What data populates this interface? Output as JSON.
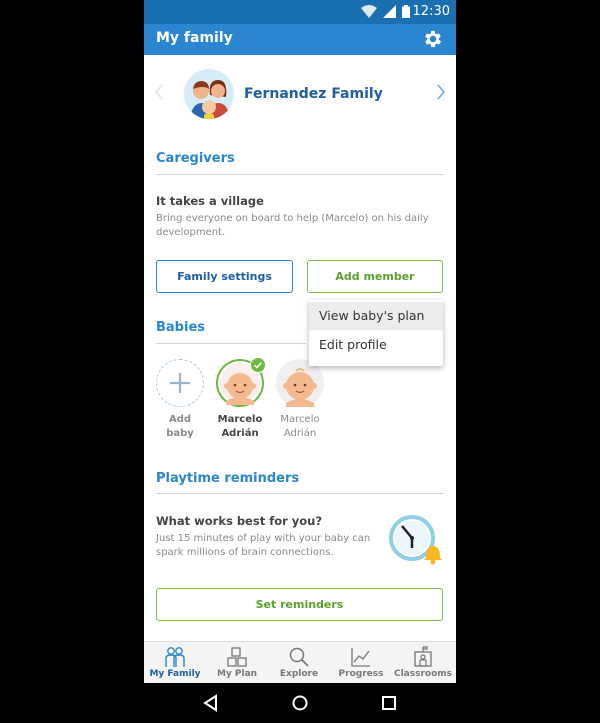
{
  "status_bar": {
    "time": "12:30",
    "icons": [
      "wifi-icon",
      "cellular-icon",
      "battery-icon"
    ]
  },
  "app_bar": {
    "title": "My family",
    "settings_icon": "gear-icon"
  },
  "family": {
    "name": "Fernandez Family",
    "prev_icon": "chevron-left-icon",
    "next_icon": "chevron-right-icon"
  },
  "caregivers": {
    "section_title": "Caregivers",
    "heading": "It takes a village",
    "description": "Bring everyone on board to help (Marcelo) on his daily development.",
    "family_settings_label": "Family settings",
    "add_member_label": "Add member"
  },
  "menu": {
    "items": [
      "View baby's plan",
      "Edit profile"
    ]
  },
  "babies": {
    "section_title": "Babies",
    "items": [
      {
        "line1": "Add",
        "line2": "baby",
        "kind": "add"
      },
      {
        "line1": "Marcelo",
        "line2": "Adrián",
        "kind": "selected"
      },
      {
        "line1": "Marcelo",
        "line2": "Adrián",
        "kind": "normal"
      }
    ]
  },
  "reminders": {
    "section_title": "Playtime reminders",
    "heading": "What works best for you?",
    "description": "Just 15 minutes of play with your baby can spark millions of brain connections.",
    "button_label": "Set reminders"
  },
  "bottom_nav": {
    "items": [
      {
        "label": "My Family",
        "icon": "family-icon",
        "active": true
      },
      {
        "label": "My Plan",
        "icon": "blocks-icon",
        "active": false
      },
      {
        "label": "Explore",
        "icon": "search-icon",
        "active": false
      },
      {
        "label": "Progress",
        "icon": "chart-icon",
        "active": false
      },
      {
        "label": "Classrooms",
        "icon": "classroom-icon",
        "active": false
      }
    ]
  },
  "colors": {
    "primary": "#2a86d0",
    "status_bar": "#1a6fb0",
    "green": "#7ac04a",
    "title_text": "#1e5fa3"
  }
}
